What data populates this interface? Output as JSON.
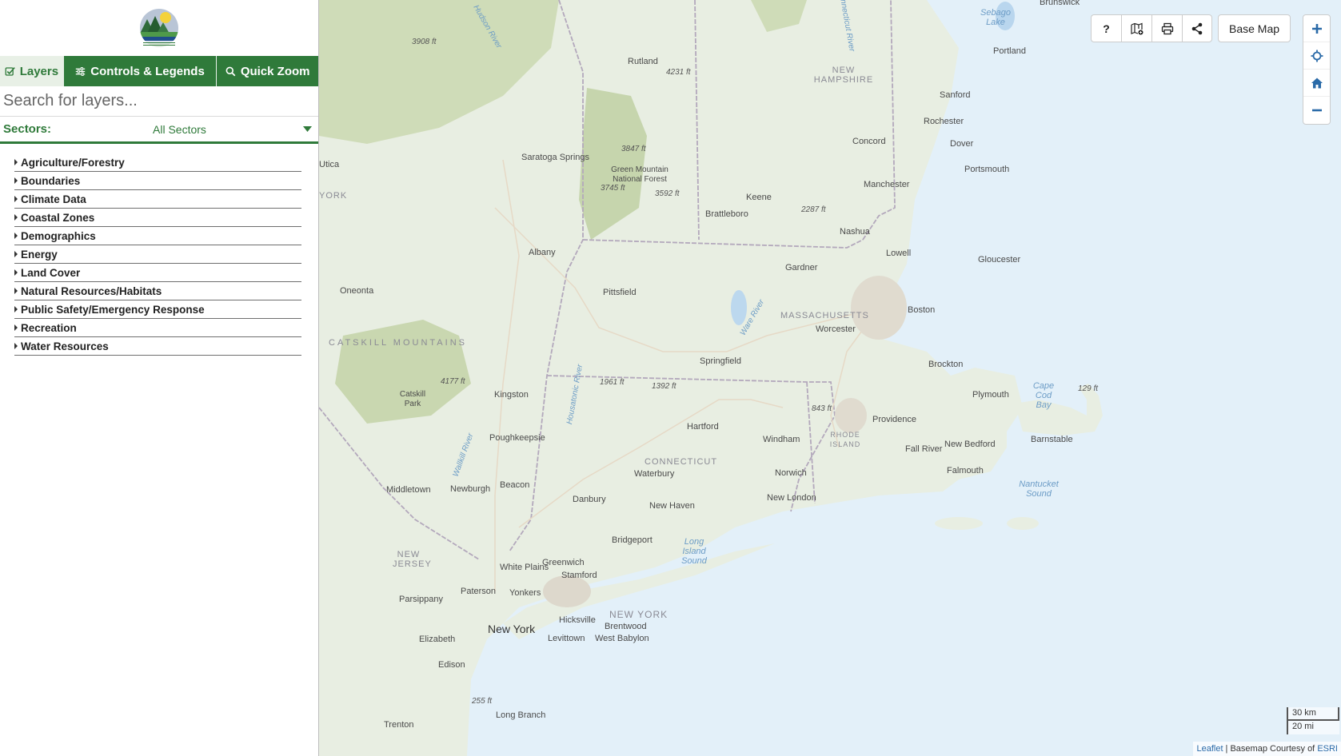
{
  "sidebar": {
    "tabs": [
      {
        "label": "Layers",
        "icon": "checkbox-icon",
        "active": true
      },
      {
        "label": "Controls & Legends",
        "icon": "sliders-icon",
        "active": false
      },
      {
        "label": "Quick Zoom",
        "icon": "search-icon",
        "active": false
      }
    ],
    "search": {
      "placeholder": "Search for layers..."
    },
    "sectors": {
      "label": "Sectors:",
      "selected": "All Sectors"
    },
    "layer_groups": [
      "Agriculture/Forestry",
      "Boundaries",
      "Climate Data",
      "Coastal Zones",
      "Demographics",
      "Energy",
      "Land Cover",
      "Natural Resources/Habitats",
      "Public Safety/Emergency Response",
      "Recreation",
      "Water Resources"
    ]
  },
  "map": {
    "toolbar": {
      "help_label": "?",
      "buttons": [
        "help-icon",
        "map-add-icon",
        "print-icon",
        "share-icon"
      ],
      "basemap_label": "Base Map"
    },
    "zoom_controls": [
      "zoom-in-icon",
      "locate-icon",
      "home-icon",
      "zoom-out-icon"
    ],
    "scale": {
      "km": "30 km",
      "mi": "20 mi"
    },
    "attribution": {
      "leaflet": "Leaflet",
      "separator": " | Basemap Courtesy of ",
      "esri": "ESRI"
    },
    "labels": {
      "cities": [
        "Brunswick",
        "Portland",
        "Sanford",
        "Rochester",
        "Dover",
        "Portsmouth",
        "Rutland",
        "Concord",
        "Manchester",
        "Keene",
        "Brattleboro",
        "Nashua",
        "Lowell",
        "Gloucester",
        "Saratoga Springs",
        "Albany",
        "Pittsfield",
        "Gardner",
        "Boston",
        "Worcester",
        "Oneonta",
        "Springfield",
        "Brockton",
        "Kingston",
        "Plymouth",
        "Hartford",
        "Windham",
        "Providence",
        "Fall River",
        "New Bedford",
        "Barnstable",
        "Falmouth",
        "Poughkeepsie",
        "Waterbury",
        "Norwich",
        "Middletown",
        "Newburgh",
        "Beacon",
        "Danbury",
        "New London",
        "New Haven",
        "Bridgeport",
        "White Plains",
        "Greenwich",
        "Stamford",
        "Paterson",
        "Yonkers",
        "Parsippany",
        "Hicksville",
        "Brentwood",
        "Levittown",
        "West Babylon",
        "Elizabeth",
        "Edison",
        "Long Branch",
        "Trenton",
        "Utica"
      ],
      "big_city": "New York",
      "regions": [
        "NEW HAMPSHIRE",
        "MASSACHUSETTS",
        "CONNECTICUT",
        "RHODE ISLAND",
        "NEW YORK",
        "NEW JERSEY",
        "CATSKILL MOUNTAINS",
        "YORK"
      ],
      "water": [
        "Sebago Lake",
        "Long Island Sound",
        "Cape Cod Bay",
        "Nantucket Sound"
      ],
      "rivers": [
        "Hudson River",
        "Connecticut River",
        "Ware River",
        "Housatonic River",
        "Wallkill River"
      ],
      "parks": [
        "Green Mountain National Forest",
        "Catskill Park"
      ],
      "elevations": [
        "3908 ft",
        "4231 ft",
        "3847 ft",
        "3745 ft",
        "3592 ft",
        "2287 ft",
        "4177 ft",
        "1961 ft",
        "1392 ft",
        "843 ft",
        "129 ft",
        "255 ft"
      ]
    }
  }
}
